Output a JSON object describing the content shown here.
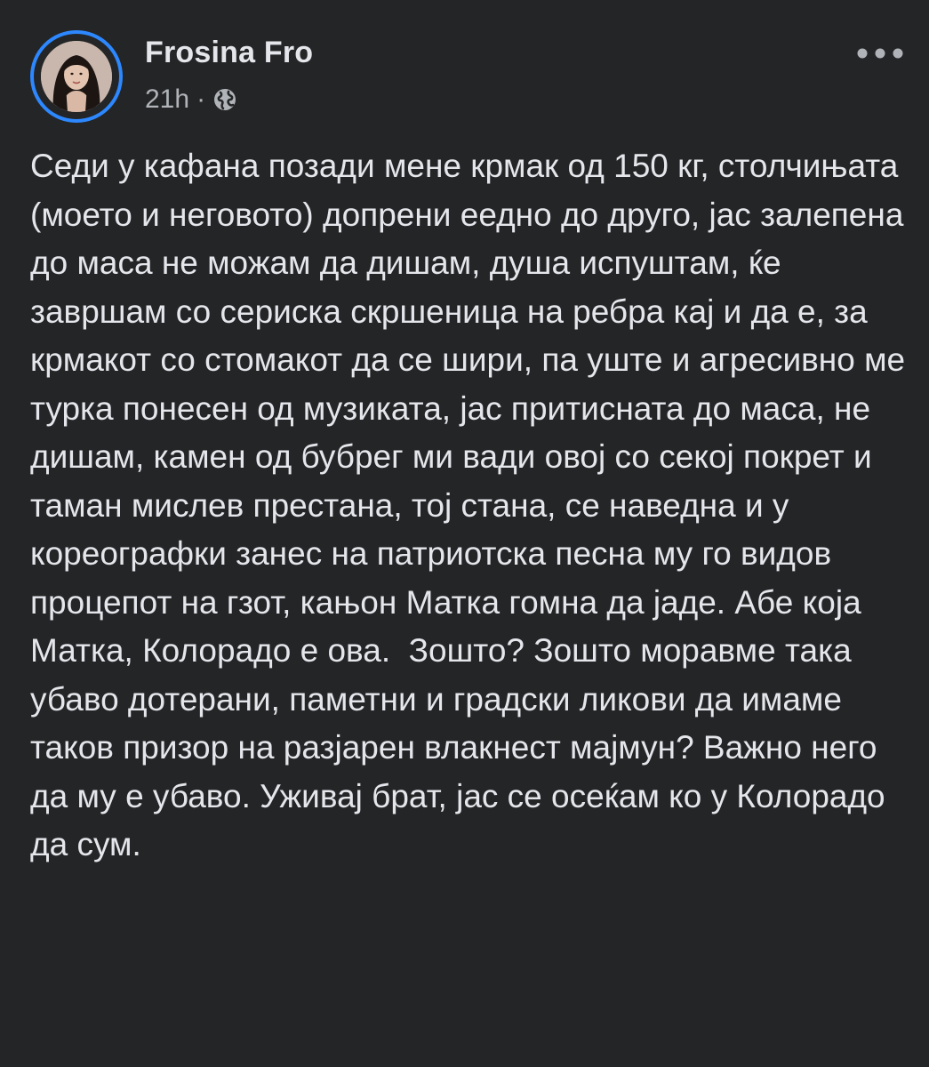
{
  "post": {
    "author": {
      "name": "Frosina Fro",
      "avatar_icon": "profile-photo"
    },
    "meta": {
      "time": "21h",
      "separator": "·",
      "audience_icon": "globe-icon"
    },
    "more_icon": "more-horizontal-icon",
    "text": "Седи у кафана позади мене крмак од 150 кг, столчињата (моето и неговото) допрени еедно до друго, јас залепена до маса не можам да дишам, душа испуштам, ќе завршам со сериска скршеница на ребра кај и да е, за крмакот со стомакот да се шири, па уште и агресивно ме турка понесен од музиката, јас притисната до маса, не дишам, камен од бубрег ми вади овој со секој покрет и таман мислев престана, тој стана, се наведна и у кореографки занес на патриотска песна му го видов процепот на гзот, кањон Матка гомна да јаде. Абе која Матка, Колорадо е ова.  Зошто? Зошто моравме така убаво дотерани, паметни и градски ликови да имаме таков призор на разјарен влакнест мајмун? Важно него да му е убаво. Уживај брат, јас се осеќам ко у Колорадо да сум."
  },
  "colors": {
    "background": "#242526",
    "text_primary": "#e4e6eb",
    "text_secondary": "#b0b3b8",
    "avatar_ring": "#2d88ff"
  }
}
